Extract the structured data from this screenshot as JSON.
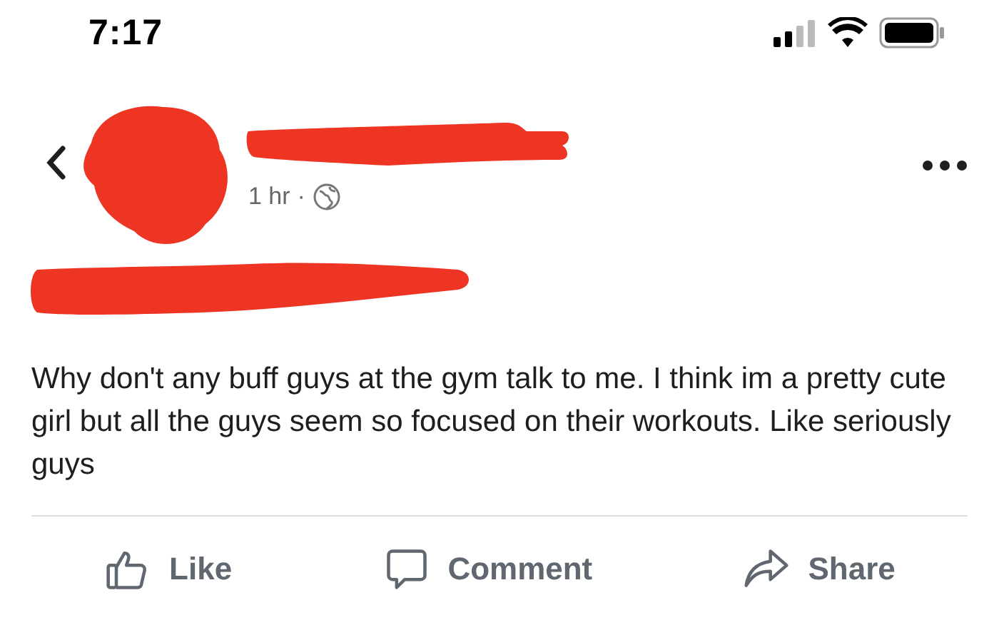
{
  "status_bar": {
    "time": "7:17"
  },
  "post": {
    "time": "1 hr",
    "separator": "·",
    "body": "Why don't any buff guys at the gym talk to me. I think im a pretty cute girl but all the guys seem so focused on their workouts. Like seriously guys"
  },
  "actions": [
    {
      "kind": "like",
      "label": "Like"
    },
    {
      "kind": "comment",
      "label": "Comment"
    },
    {
      "kind": "share",
      "label": "Share"
    }
  ]
}
